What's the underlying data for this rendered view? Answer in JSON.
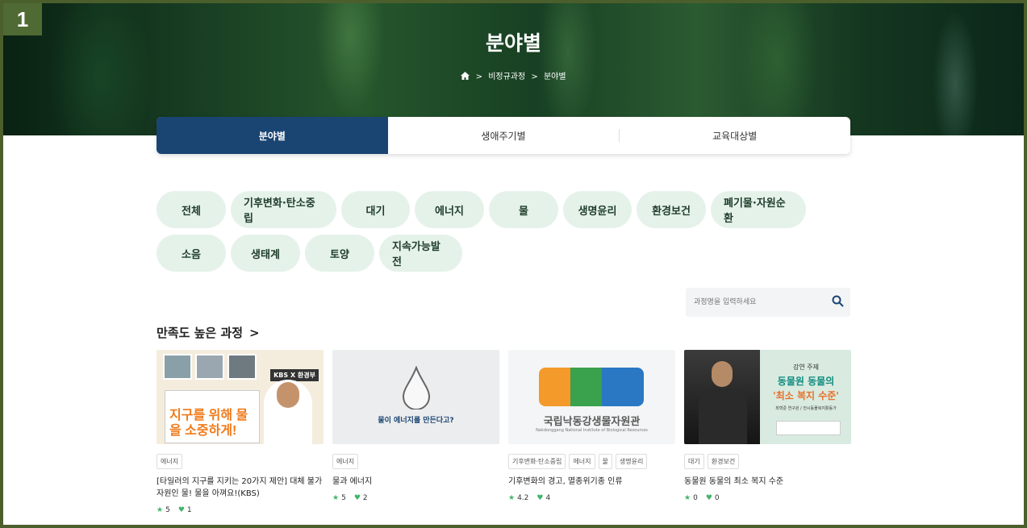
{
  "badge": "1",
  "hero": {
    "title": "분야별",
    "breadcrumb": [
      ">",
      "비정규과정",
      ">",
      "분야별"
    ]
  },
  "tabs": [
    "분야별",
    "생애주기별",
    "교육대상별"
  ],
  "chips_row1": [
    "전체",
    "기후변화·탄소중립",
    "대기",
    "에너지",
    "물",
    "생명윤리",
    "환경보건",
    "폐기물·자원순환"
  ],
  "chips_row2": [
    "소음",
    "생태계",
    "토양",
    "지속가능발전"
  ],
  "search": {
    "placeholder": "과정명을 입력하세요"
  },
  "section": {
    "title": "만족도 높은 과정",
    "arrow": ">"
  },
  "cards": [
    {
      "thumb": {
        "badge": "KBS X 환경부",
        "text": "지구를 위해 물을 소중하게!"
      },
      "tags": [
        "에너지"
      ],
      "title": "[타일러의 지구를 지키는 20가지 제안] 대체 불가 자원인 물! 물을 아껴요!(KBS)",
      "rating": "5",
      "likes": "1"
    },
    {
      "thumb": {
        "text": "물이 에너지를 만든다고?"
      },
      "tags": [
        "에너지"
      ],
      "title": "물과 에너지",
      "rating": "5",
      "likes": "2"
    },
    {
      "thumb": {
        "text": "국립낙동강생물자원관",
        "sub": "Nakdonggang National Institute of Biological Resources"
      },
      "tags": [
        "기후변화·탄소중립",
        "에너지",
        "물",
        "생명윤리"
      ],
      "title": "기후변화의 경고, 멸종위기종 인류",
      "rating": "4.2",
      "likes": "4"
    },
    {
      "thumb": {
        "lecture": "강연 주제",
        "line1": "동물원 동물의",
        "line2": "'최소 복지 수준'",
        "author": "최혁준 연구원 / 전시동물복지활동가"
      },
      "tags": [
        "대기",
        "환경보건"
      ],
      "title": "동물원 동물의 최소 복지 수준",
      "rating": "0",
      "likes": "0"
    }
  ],
  "colors": {
    "accent": "#1a4472",
    "chip_bg": "#e5f2ea",
    "star": "#3fb56b",
    "heart": "#3fb56b"
  }
}
